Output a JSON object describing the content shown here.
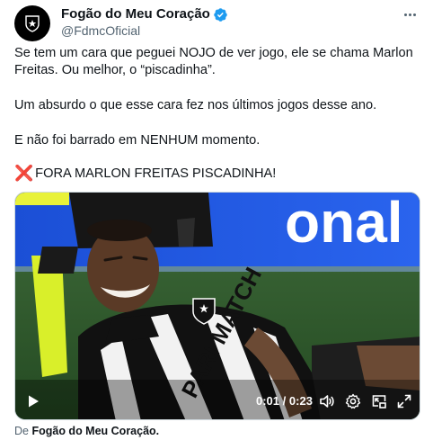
{
  "author": {
    "display_name": "Fogão do Meu Coração",
    "handle": "@FdmcOficial",
    "verified": true,
    "accent_color": "#1d9bf0"
  },
  "tweet": {
    "paragraphs": [
      "Se tem um cara que peguei NOJO de ver jogo, ele se chama Marlon Freitas. Ou melhor, o “piscadinha”.",
      "Um absurdo o que esse cara fez nos últimos jogos desse ano.",
      "E não foi barrado em NENHUM momento.",
      "FORA MARLON FREITAS PISCADINHA!"
    ],
    "emoji": "❌"
  },
  "video": {
    "current_time": "0:01",
    "separator": "/",
    "duration": "0:23",
    "jersey_sponsor": "PARI MATCH",
    "banner_text": "onal"
  },
  "attribution": {
    "prefix": "De",
    "source": "Fogão do Meu Coração."
  },
  "icons": {
    "more": "more-horizontal-icon",
    "verified": "verified-badge-icon",
    "play": "play-icon",
    "volume": "volume-icon",
    "settings": "settings-gear-icon",
    "pip": "picture-in-picture-icon",
    "fullscreen": "fullscreen-icon"
  }
}
